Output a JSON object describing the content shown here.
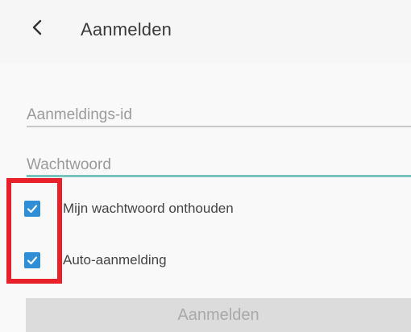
{
  "header": {
    "back_icon": "chevron-left-icon",
    "title": "Aanmelden"
  },
  "form": {
    "id_field": {
      "placeholder": "Aanmeldings-id",
      "value": ""
    },
    "password_field": {
      "placeholder": "Wachtwoord",
      "value": ""
    },
    "remember_password": {
      "label": "Mijn wachtwoord onthouden",
      "checked": true
    },
    "auto_login": {
      "label": "Auto-aanmelding",
      "checked": true
    },
    "submit_label": "Aanmelden",
    "submit_enabled": false
  },
  "colors": {
    "accent": "#2f8fd6",
    "focus_underline": "#79c3be",
    "highlight": "#e8202a",
    "button_disabled_bg": "#dcdcdc",
    "button_disabled_text": "#a9a9a9"
  }
}
